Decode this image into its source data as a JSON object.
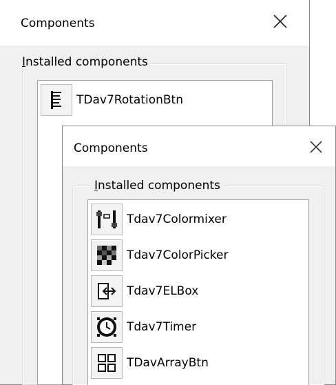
{
  "back_dialog": {
    "title": "Components",
    "group_label_accel": "I",
    "group_label_rest": "nstalled components",
    "items": [
      {
        "label": "TDav7RotationBtn",
        "icon": "rotation-button-icon"
      }
    ]
  },
  "front_dialog": {
    "title": "Components",
    "group_label_accel": "I",
    "group_label_rest": "nstalled components",
    "items": [
      {
        "label": "Tdav7Colormixer",
        "icon": "color-mixer-icon"
      },
      {
        "label": "Tdav7ColorPicker",
        "icon": "color-picker-icon"
      },
      {
        "label": "Tdav7ELBox",
        "icon": "elbox-icon"
      },
      {
        "label": "Tdav7Timer",
        "icon": "timer-icon"
      },
      {
        "label": "TDavArrayBtn",
        "icon": "array-button-icon"
      }
    ]
  },
  "colors": {
    "dialog_bg": "#f0f0f0",
    "title_bg": "#ffffff",
    "list_bg": "#ffffff"
  }
}
